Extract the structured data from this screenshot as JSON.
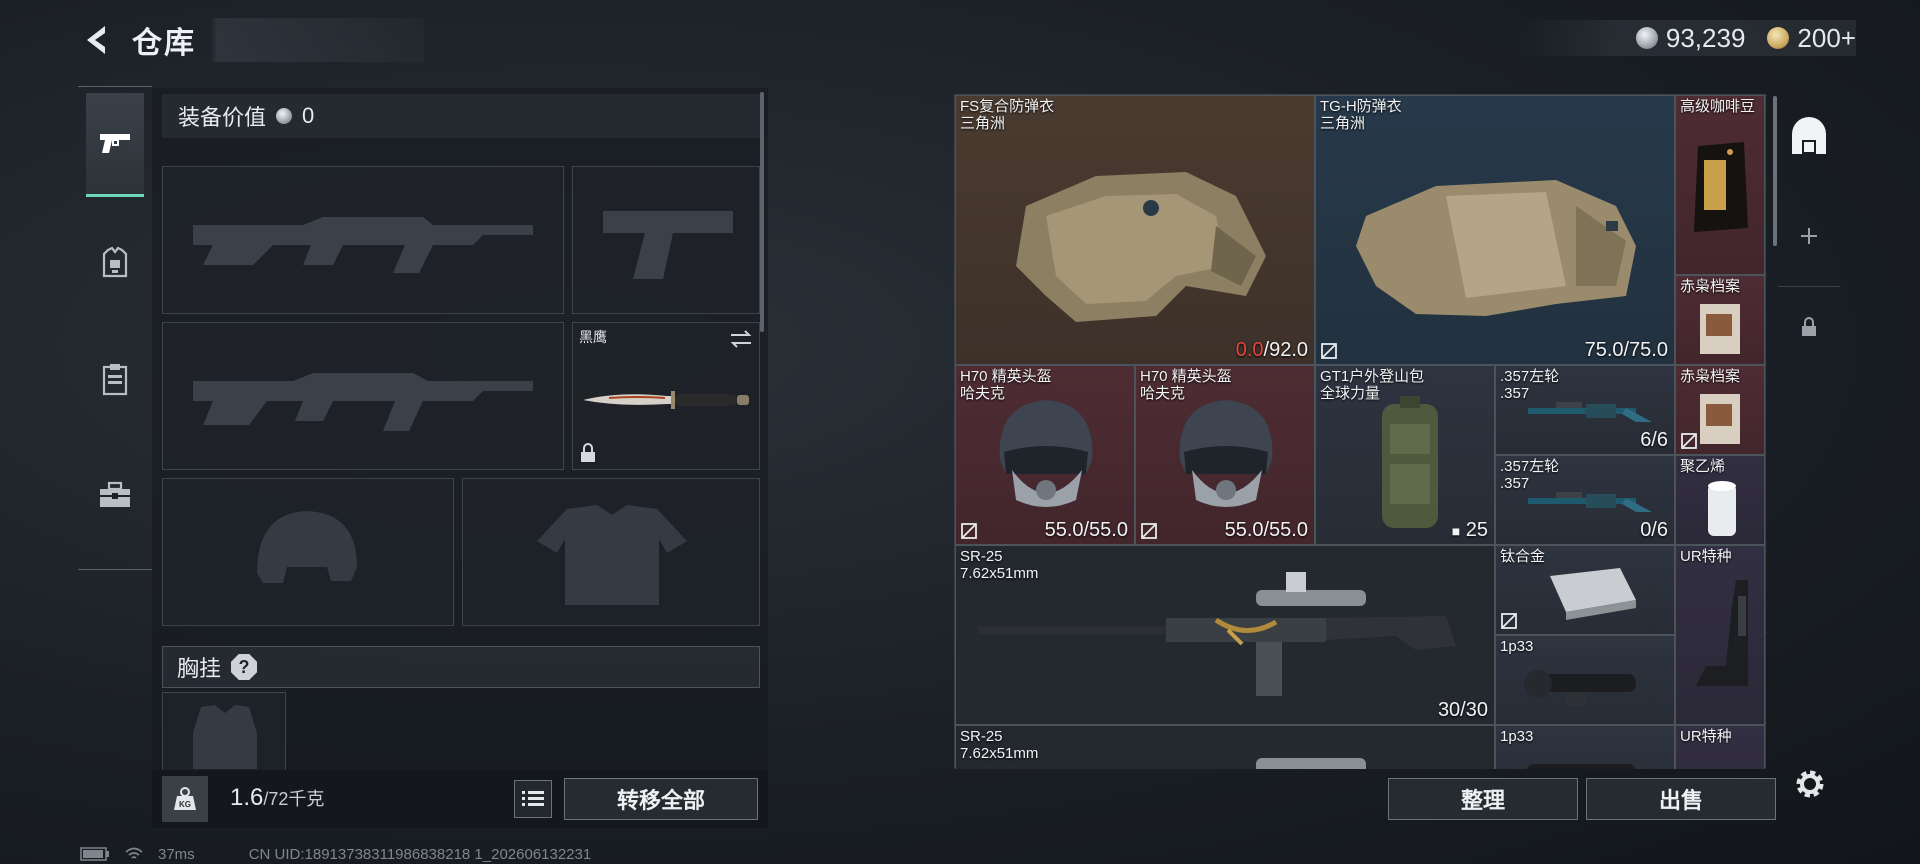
{
  "header": {
    "title": "仓库"
  },
  "currency": {
    "coins": "93,239",
    "tokens": "200+"
  },
  "equipment": {
    "value_label": "装备价值",
    "value": "0",
    "knife_name": "黑鹰",
    "rig_label": "胸挂",
    "rig_help": "?",
    "weight": "1.6",
    "weight_max": "/72千克",
    "transfer_label": "转移全部"
  },
  "storage": {
    "items": [
      {
        "name": "FS复合防弹衣",
        "sub": "三角洲",
        "val_cur": "0.0",
        "val_max": "/92.0"
      },
      {
        "name": "TG-H防弹衣",
        "sub": "三角洲",
        "val": "75.0/75.0"
      },
      {
        "name": "高级咖啡豆"
      },
      {
        "name": "赤枭档案"
      },
      {
        "name": "H70 精英头盔",
        "sub": "哈夫克",
        "val": "55.0/55.0"
      },
      {
        "name": "H70 精英头盔",
        "sub": "哈夫克",
        "val": "55.0/55.0"
      },
      {
        "name": "GT1户外登山包",
        "sub": "全球力量",
        "val": "25"
      },
      {
        "name": ".357左轮",
        "sub": ".357",
        "val": "6/6"
      },
      {
        "name": "赤枭档案"
      },
      {
        "name": ".357左轮",
        "sub": ".357",
        "val": "0/6"
      },
      {
        "name": "聚乙烯"
      },
      {
        "name": "SR-25",
        "sub": "7.62x51mm",
        "val": "30/30"
      },
      {
        "name": "钛合金"
      },
      {
        "name": "UR特种"
      },
      {
        "name": "1p33"
      },
      {
        "name": "SR-25",
        "sub": "7.62x51mm"
      },
      {
        "name": "1p33"
      },
      {
        "name": "UR特种"
      }
    ],
    "sort_label": "整理",
    "sell_label": "出售"
  },
  "status": {
    "ping": "37ms",
    "uid": "CN UID:18913738311986838218 1_202606132231"
  },
  "colors": {
    "accent": "#6fd7b8",
    "durability_low": "#e0453f"
  },
  "icons": [
    "back-arrow-icon",
    "pistol-icon",
    "armor-icon",
    "clipboard-icon",
    "toolbox-icon",
    "weight-icon",
    "list-icon",
    "swap-icon",
    "lock-icon",
    "no-trade-icon",
    "helmet-icon",
    "safe-icon",
    "plus-icon",
    "settings-icon",
    "battery-icon",
    "wifi-icon"
  ]
}
